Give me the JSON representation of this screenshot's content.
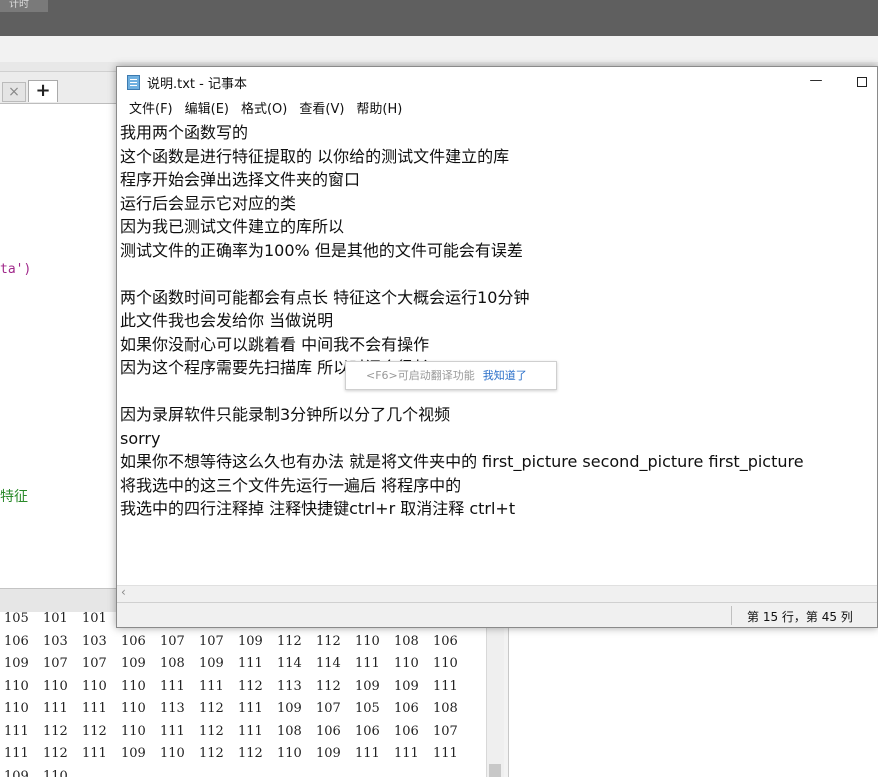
{
  "background": {
    "top_tab_label": "计时",
    "close_tab_glyph": "×",
    "add_tab_glyph": "+",
    "code_fragment_1": "ta')",
    "code_fragment_2": "特征",
    "number_rows": [
      [
        "105",
        "101",
        "101"
      ],
      [
        "106",
        "103",
        "103",
        "106",
        "107",
        "107",
        "109",
        "112",
        "112",
        "110",
        "108",
        "106"
      ],
      [
        "109",
        "107",
        "107",
        "109",
        "108",
        "109",
        "111",
        "114",
        "114",
        "111",
        "110",
        "110"
      ],
      [
        "110",
        "110",
        "110",
        "110",
        "111",
        "111",
        "112",
        "113",
        "112",
        "109",
        "109",
        "111"
      ],
      [
        "110",
        "111",
        "111",
        "110",
        "113",
        "112",
        "111",
        "109",
        "107",
        "105",
        "106",
        "108"
      ],
      [
        "111",
        "112",
        "112",
        "110",
        "111",
        "112",
        "111",
        "108",
        "106",
        "106",
        "106",
        "107"
      ],
      [
        "111",
        "112",
        "111",
        "109",
        "110",
        "112",
        "112",
        "110",
        "109",
        "111",
        "111",
        "111"
      ],
      [
        "109",
        "110"
      ]
    ]
  },
  "notepad": {
    "title": "说明.txt - 记事本",
    "minimize_glyph": "—",
    "menu": [
      "文件(F)",
      "编辑(E)",
      "格式(O)",
      "查看(V)",
      "帮助(H)"
    ],
    "lines": [
      "我用两个函数写的",
      "这个函数是进行特征提取的  以你给的测试文件建立的库",
      "程序开始会弹出选择文件夹的窗口",
      "运行后会显示它对应的类",
      "因为我已测试文件建立的库所以",
      "测试文件的正确率为100% 但是其他的文件可能会有误差",
      "",
      "两个函数时间可能都会有点长 特征这个大概会运行10分钟",
      "此文件我也会发给你 当做说明",
      "如果你没耐心可以跳着看 中间我不会有操作",
      "因为这个程序需要先扫描库 所以时间会很长",
      "",
      "因为录屏软件只能录制3分钟所以分了几个视频",
      "sorry",
      "如果你不想等待这么久也有办法 就是将文件夹中的 first_picture second_picture first_picture",
      "将我选中的这三个文件先运行一遍后 将程序中的",
      "我选中的四行注释掉 注释快捷键ctrl+r 取消注释 ctrl+t"
    ],
    "scroll_left_glyph": "‹",
    "status": "第 15 行，第 45 列"
  },
  "tooltip": {
    "message": "<F6>可启动翻译功能",
    "link": "我知道了"
  }
}
